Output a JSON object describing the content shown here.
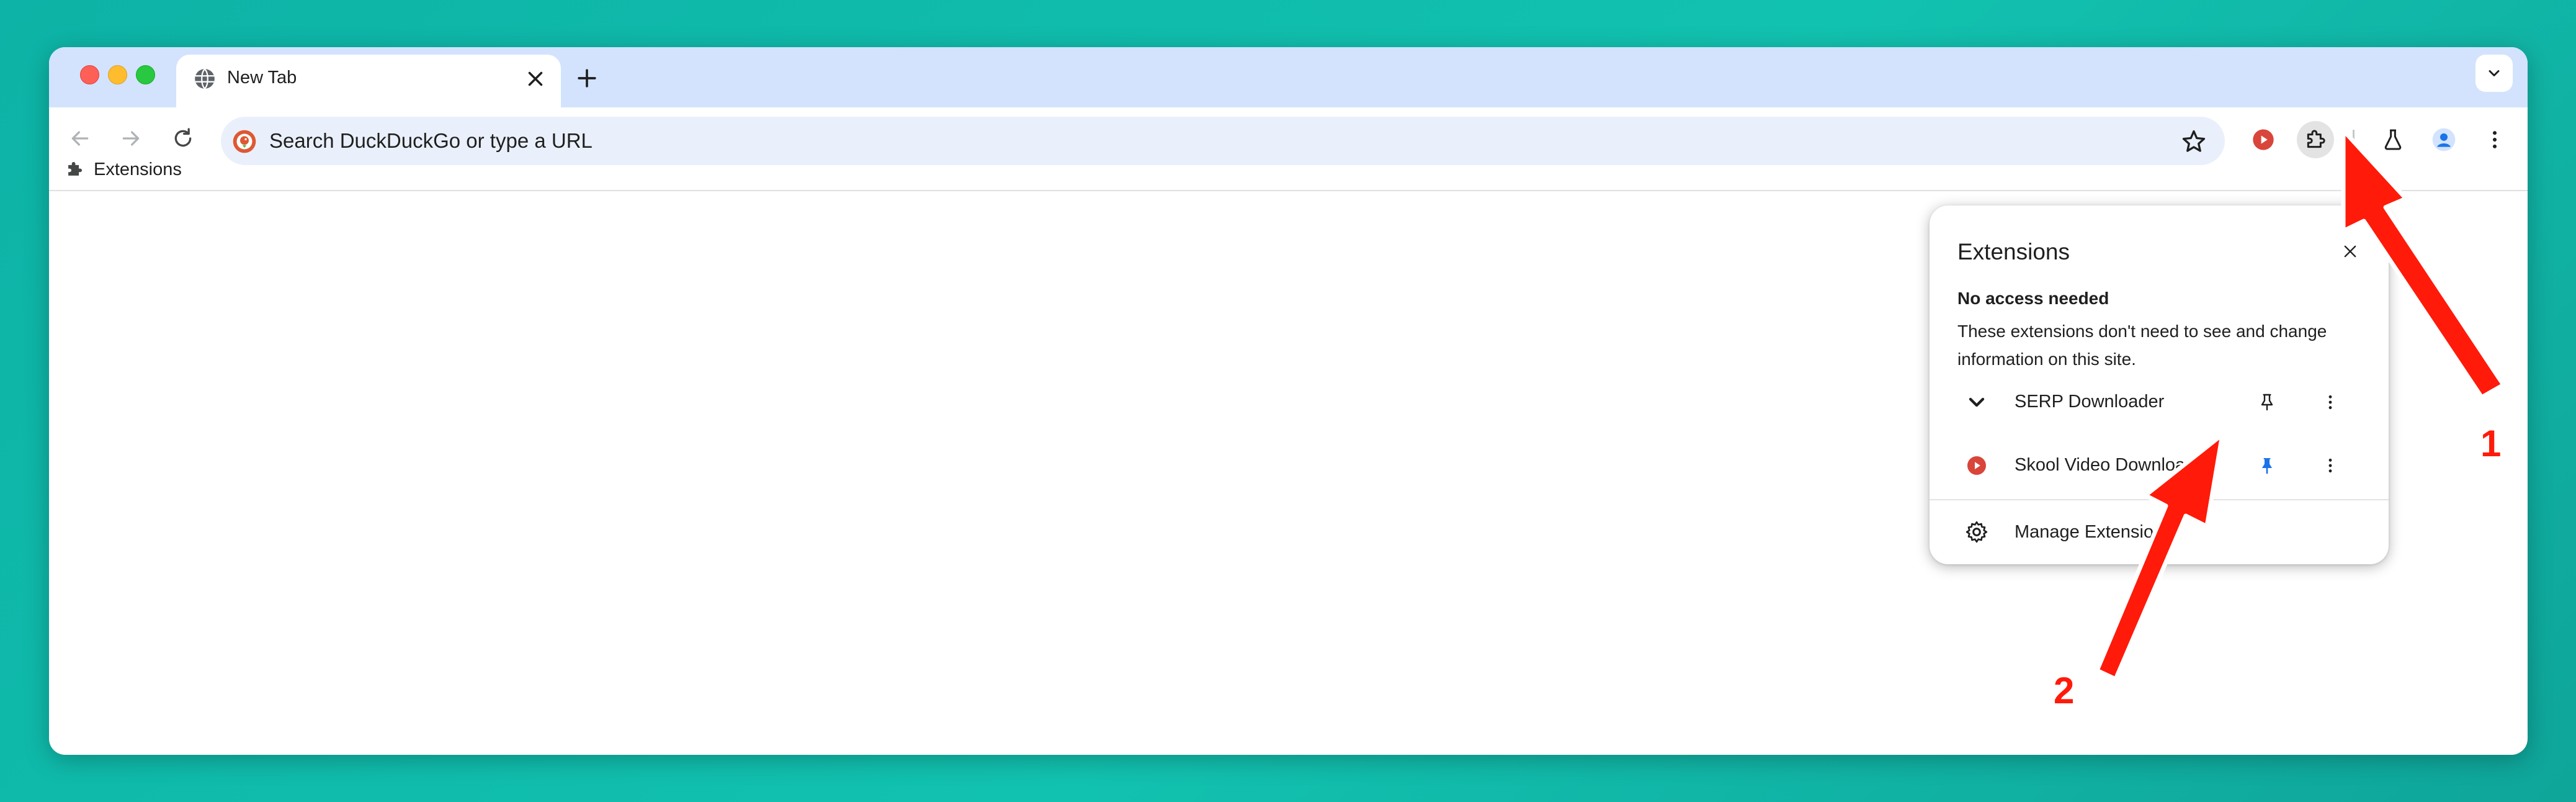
{
  "browser": {
    "tab": {
      "title": "New Tab"
    },
    "omnibox": {
      "placeholder": "Search DuckDuckGo or type a URL"
    },
    "bookmarks_bar": {
      "items": [
        {
          "label": "Extensions"
        }
      ]
    }
  },
  "extensions_popup": {
    "title": "Extensions",
    "section_heading": "No access needed",
    "section_description": "These extensions don't need to see and change information on this site.",
    "items": [
      {
        "name": "SERP Downloader",
        "pinned": false
      },
      {
        "name": "Skool Video Downloader",
        "pinned": true
      }
    ],
    "manage_label": "Manage Extensions"
  },
  "annotations": {
    "step1": "1",
    "step2": "2"
  },
  "colors": {
    "background": "#0db3a6",
    "tabstrip": "#d3e3fd",
    "pin_active": "#1a73e8",
    "annotation_red": "#ff1a0a"
  }
}
